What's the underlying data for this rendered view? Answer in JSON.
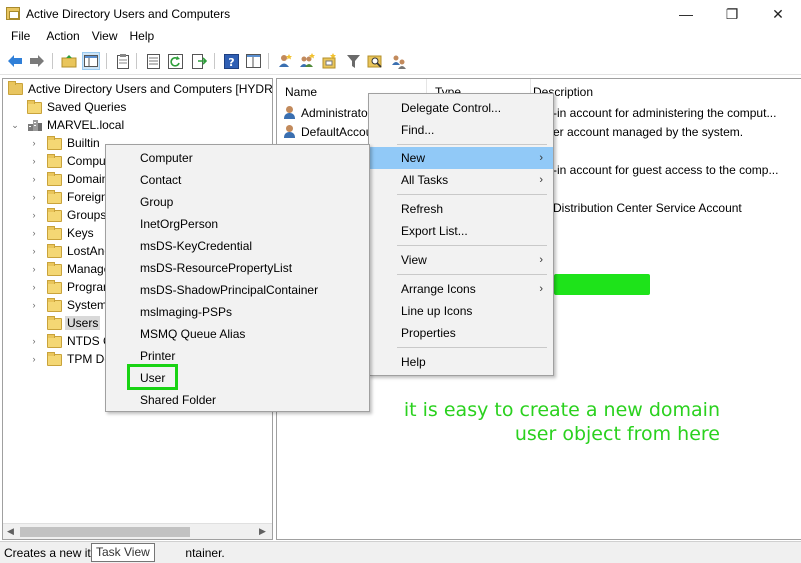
{
  "window": {
    "title": "Active Directory Users and Computers",
    "minimize_glyph": "—",
    "restore_glyph": "❐",
    "close_glyph": "✕"
  },
  "menubar": [
    "File",
    "Action",
    "View",
    "Help"
  ],
  "toolbar": {
    "icons": [
      "back-icon",
      "forward-icon",
      "up-folder-icon",
      "show-hide-tree-icon",
      "clipboard-icon",
      "properties-icon",
      "refresh-icon",
      "export-list-icon",
      "help-icon",
      "view-icon",
      "add-user-icon",
      "add-group-icon",
      "add-ou-icon",
      "filter-icon",
      "find-icon",
      "delegate-icon"
    ]
  },
  "tree": {
    "root": "Active Directory Users and Computers [HYDRA",
    "saved_queries": "Saved Queries",
    "domain": "MARVEL.local",
    "children": [
      "Builtin",
      "Compu",
      "Domain",
      "Foreign",
      "Groups",
      "Keys",
      "LostAnd",
      "Manage",
      "Progran",
      "System",
      "Users",
      "NTDS C",
      "TPM De"
    ]
  },
  "list": {
    "columns": [
      "Name",
      "Type",
      "Description"
    ],
    "rows": [
      {
        "name": "Administrato",
        "description": "-in account for administering the comput..."
      },
      {
        "name": "DefaultAccou",
        "description": "er account managed by the system."
      },
      {
        "name": "",
        "description": "-in account for guest access to the comp..."
      },
      {
        "name": "",
        "description": "Distribution Center Service Account"
      }
    ]
  },
  "context_menu": {
    "items": [
      "Delegate Control...",
      "Find...",
      "New",
      "All Tasks",
      "Refresh",
      "Export List...",
      "View",
      "Arrange Icons",
      "Line up Icons",
      "Properties",
      "Help"
    ],
    "highlighted": "New"
  },
  "new_submenu": {
    "items": [
      "Computer",
      "Contact",
      "Group",
      "InetOrgPerson",
      "msDS-KeyCredential",
      "msDS-ResourcePropertyList",
      "msDS-ShadowPrincipalContainer",
      "mslmaging-PSPs",
      "MSMQ Queue Alias",
      "Printer",
      "User",
      "Shared Folder"
    ],
    "boxed": "User"
  },
  "statusbar": {
    "text": "Creates a new ite",
    "text_tail": "ntainer.",
    "tooltip": "Task View"
  },
  "annotation": {
    "line1": "it is easy to create a new domain",
    "line2": "user object from here",
    "color": "#2ad11e"
  }
}
